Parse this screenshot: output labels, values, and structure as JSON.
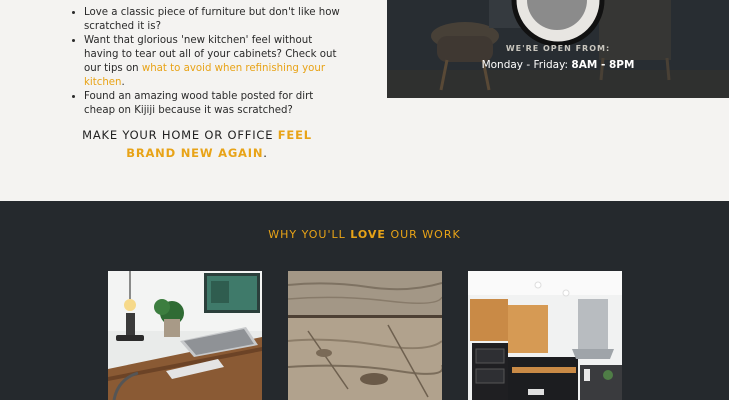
{
  "bullets": [
    {
      "text": "Love a classic piece of furniture but don't like how scratched it is?"
    },
    {
      "text_before": "Want that glorious 'new kitchen' feel without having to tear out all of your cabinets? Check out our tips on ",
      "link": "what to avoid when refinishing your kitchen",
      "text_after": "."
    },
    {
      "text": "Found an amazing wood table posted for dirt cheap on Kijiji because it was scratched?"
    }
  ],
  "cta": {
    "before": "MAKE YOUR HOME OR OFFICE ",
    "highlight": "FEEL BRAND NEW AGAIN",
    "after": "."
  },
  "hours": {
    "label": "WE'RE OPEN FROM:",
    "days": "Monday - Friday: ",
    "time": "8AM - 8PM"
  },
  "work": {
    "before": "WHY YOU'LL ",
    "bold": "LOVE",
    "after": " OUR WORK"
  },
  "colors": {
    "accent": "#e8a317",
    "dark_bg": "#25292d",
    "light_bg": "#f4f3f1"
  },
  "cards": [
    {
      "icon": "desk-workspace-image"
    },
    {
      "icon": "weathered-wood-image"
    },
    {
      "icon": "modern-kitchen-image"
    }
  ]
}
